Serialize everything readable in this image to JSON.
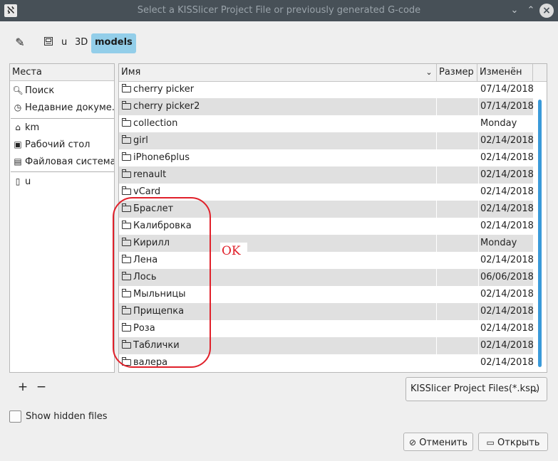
{
  "window": {
    "title": "Select a KISSlicer Project File or previously generated G-code"
  },
  "path_bar": {
    "crumbs": [
      "u",
      "3D",
      "models"
    ]
  },
  "places": {
    "header": "Места",
    "items": [
      {
        "label": "Поиск",
        "icon": "search-icon"
      },
      {
        "label": "Недавние докуме...",
        "icon": "recent-icon"
      },
      {
        "label": "km",
        "icon": "home-icon"
      },
      {
        "label": "Рабочий стол",
        "icon": "desktop-icon"
      },
      {
        "label": "Файловая система",
        "icon": "drive-icon"
      },
      {
        "label": "u",
        "icon": "document-icon"
      }
    ]
  },
  "files": {
    "columns": {
      "name": "Имя",
      "size": "Размер",
      "modified": "Изменён"
    },
    "rows": [
      {
        "name": "cherry picker",
        "date": "07/14/2018"
      },
      {
        "name": "cherry picker2",
        "date": "07/14/2018"
      },
      {
        "name": "collection",
        "date": "Monday"
      },
      {
        "name": "girl",
        "date": "02/14/2018"
      },
      {
        "name": "iPhone6plus",
        "date": "02/14/2018"
      },
      {
        "name": "renault",
        "date": "02/14/2018"
      },
      {
        "name": "vCard",
        "date": "02/14/2018"
      },
      {
        "name": "Браслет",
        "date": "02/14/2018"
      },
      {
        "name": "Калибровка",
        "date": "02/14/2018"
      },
      {
        "name": "Кирилл",
        "date": "Monday"
      },
      {
        "name": "Лена",
        "date": "02/14/2018"
      },
      {
        "name": "Лось",
        "date": "06/06/2018"
      },
      {
        "name": "Мыльницы",
        "date": "02/14/2018"
      },
      {
        "name": "Прищепка",
        "date": "02/14/2018"
      },
      {
        "name": "Роза",
        "date": "02/14/2018"
      },
      {
        "name": "Таблички",
        "date": "02/14/2018"
      },
      {
        "name": "валера",
        "date": "02/14/2018"
      }
    ]
  },
  "filter": {
    "selected": "KISSlicer Project Files(*.ksp)"
  },
  "hidden_files": {
    "label": "Show hidden files",
    "checked": false
  },
  "buttons": {
    "cancel": "Отменить",
    "open": "Открыть"
  },
  "annotation": {
    "text": "OK",
    "color": "#e0202a"
  },
  "colors": {
    "accent": "#93cee9",
    "scrollbar": "#3a9ad9",
    "titlebar": "#475057"
  }
}
